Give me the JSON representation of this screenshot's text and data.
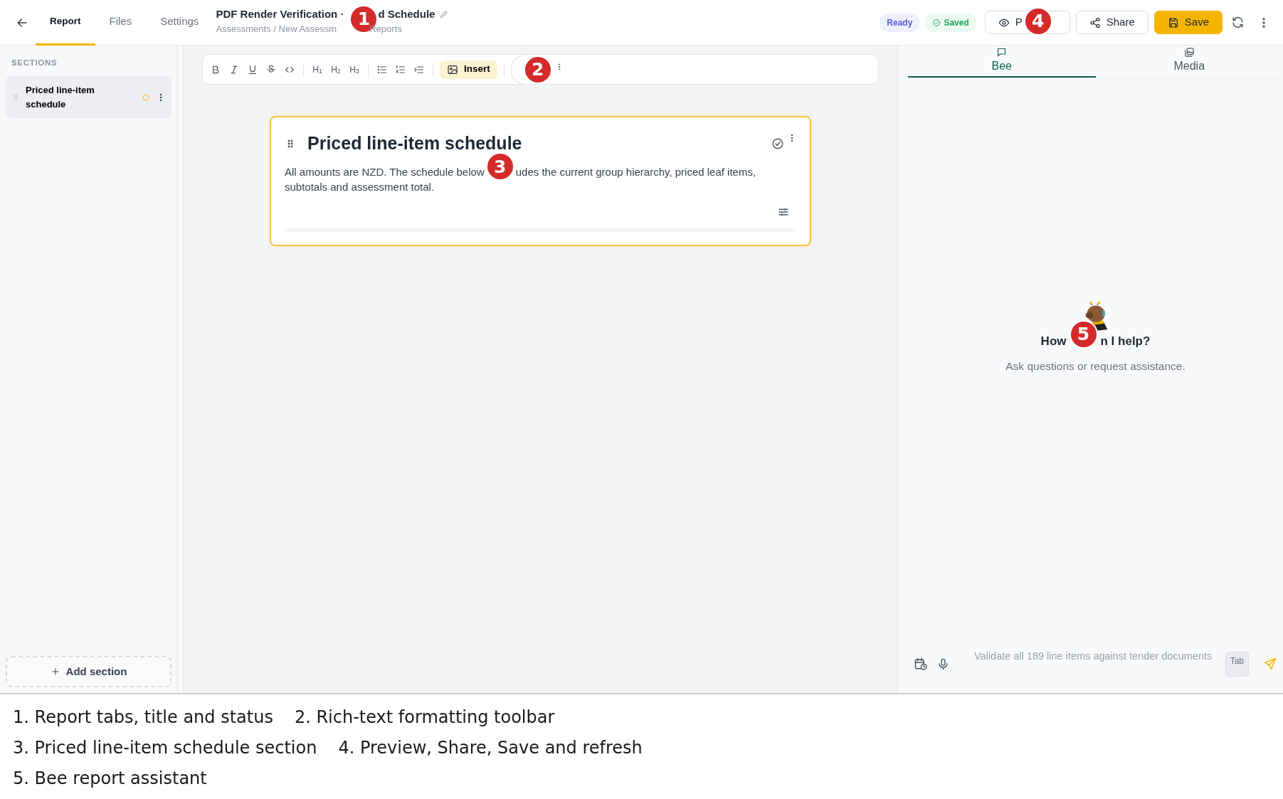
{
  "header": {
    "tabs": [
      {
        "label": "Report",
        "selected": true
      },
      {
        "label": "Files",
        "selected": false
      },
      {
        "label": "Settings",
        "selected": false
      }
    ],
    "title_parts": [
      "PDF Render Verification ·",
      "d Schedule"
    ],
    "title_callout": "1",
    "breadcrumb_parts": [
      "Assessments / New Assessm",
      "Reports"
    ],
    "badges": [
      {
        "label": "Ready",
        "kind": "status"
      },
      {
        "label": "Saved",
        "kind": "saved"
      }
    ],
    "actions": [
      {
        "label": "P",
        "kind": "preview",
        "callout": "4"
      },
      {
        "label": "Share",
        "kind": "share"
      },
      {
        "label": "Save",
        "kind": "save"
      }
    ]
  },
  "sidebar": {
    "heading": "SECTIONS",
    "items": [
      {
        "label": "Priced line-item schedule",
        "selected": true
      }
    ],
    "add_button": "Add section"
  },
  "toolbar": {
    "headings": [
      "H$_{1}$",
      "H$_{2}$",
      "H$_{3}$"
    ],
    "insert": "Insert",
    "callout": "2"
  },
  "section": {
    "title": "Priced line-item schedule",
    "body_parts": [
      "All amounts are NZD. The schedule below",
      "udes the current group hierarchy, priced leaf items,",
      "subtotals and assessment total."
    ],
    "callout": "3"
  },
  "assistant": {
    "tabs": [
      {
        "label": "Bee",
        "kind": "chat",
        "selected": true
      },
      {
        "label": "Media",
        "kind": "media",
        "selected": false
      }
    ],
    "heading_parts": [
      "How",
      "n I help?"
    ],
    "callout": "5",
    "subtitle": "Ask questions or request assistance.",
    "input": {
      "placeholder": "Validate all 189 line items against tender documents",
      "key_hint": "Tab"
    }
  },
  "legend": [
    "1. Report tabs, title and status",
    "2. Rich-text formatting toolbar",
    "3. Priced line-item schedule section",
    "4. Preview, Share, Save and refresh",
    "5. Bee report assistant"
  ]
}
